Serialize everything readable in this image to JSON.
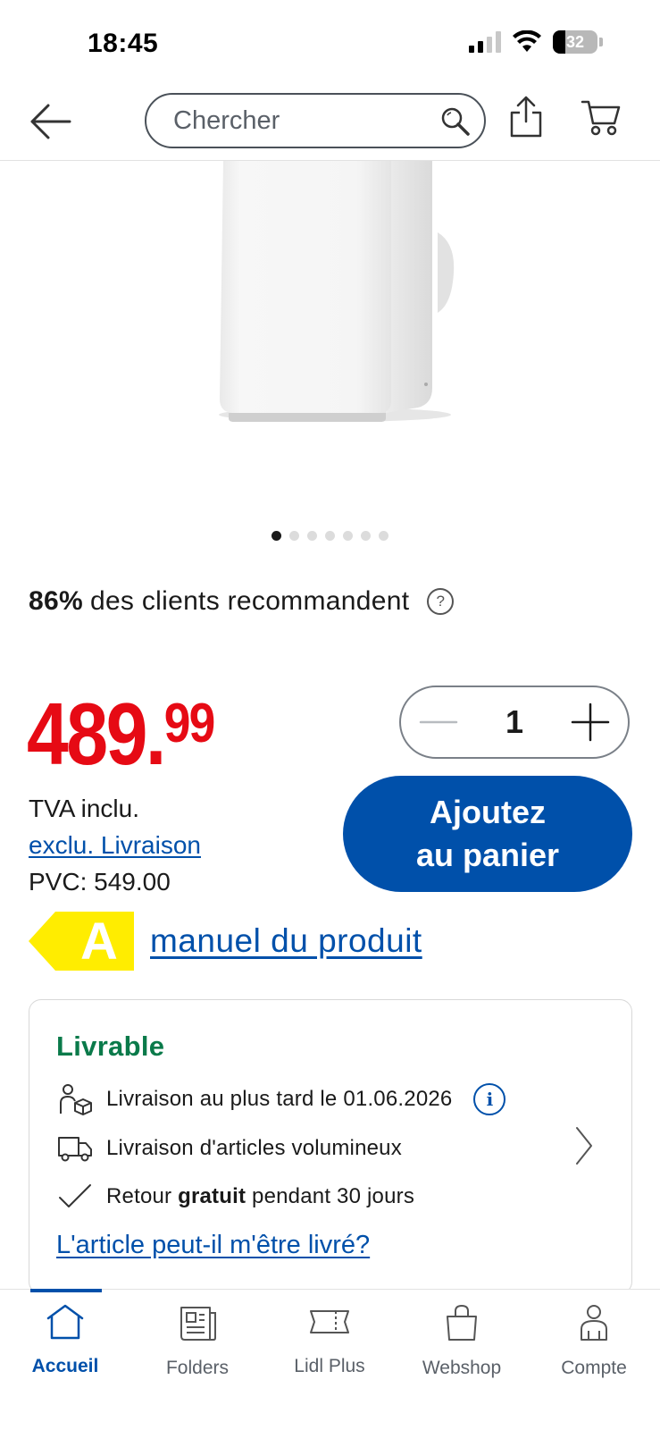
{
  "status_bar": {
    "time": "18:45",
    "battery": "32"
  },
  "header": {
    "search_placeholder": "Chercher",
    "icons": [
      "back-arrow-icon",
      "search-icon",
      "share-icon",
      "cart-icon"
    ]
  },
  "product": {
    "image_alt": "portable-air-conditioner",
    "carousel": {
      "total": 7,
      "active": 1
    },
    "recommend_percent": "86%",
    "recommend_text": "des clients recommandent",
    "price_main": "489.",
    "price_cents": "99",
    "quantity": "1",
    "tva": "TVA inclu.",
    "delivery_link": "exclu. Livraison",
    "pvc": "PVC: 549.00",
    "add_to_cart_line1": "Ajoutez",
    "add_to_cart_line2": "au panier",
    "energy_class": "A",
    "manual_link": "manuel du produit"
  },
  "delivery": {
    "status": "Livrable",
    "latest_delivery": "Livraison au plus tard le 01.06.2026",
    "bulky": "Livraison d'articles volumineux",
    "return_prefix": "Retour ",
    "return_bold": "gratuit",
    "return_suffix": " pendant 30 jours",
    "can_deliver_link": "L'article peut-il m'être livré?"
  },
  "bottom_nav": {
    "items": [
      {
        "label": "Accueil",
        "icon": "home-icon",
        "active": true
      },
      {
        "label": "Folders",
        "icon": "folder-icon",
        "active": false
      },
      {
        "label": "Lidl Plus",
        "icon": "ticket-icon",
        "active": false
      },
      {
        "label": "Webshop",
        "icon": "shopping-bag-icon",
        "active": false
      },
      {
        "label": "Compte",
        "icon": "account-icon",
        "active": false
      }
    ]
  },
  "colors": {
    "brand_blue": "#0050aa",
    "price_red": "#e60a14",
    "available_green": "#0a7a4a",
    "energy_yellow": "#ffed00"
  }
}
